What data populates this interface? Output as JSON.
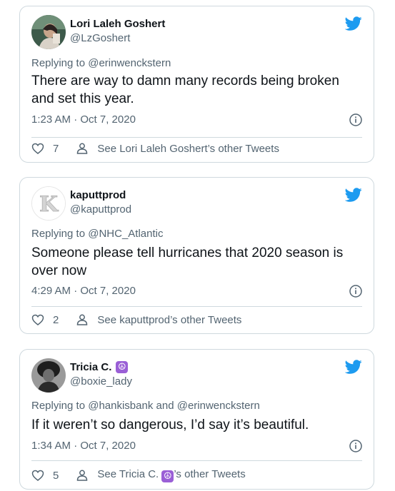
{
  "colors": {
    "twitter_blue": "#1d9bf0",
    "text_primary": "#0f1419",
    "text_secondary": "#536471",
    "border": "#cfd9de",
    "badge_purple": "#9a5fd6"
  },
  "tweets": [
    {
      "name": "Lori Laleh Goshert",
      "handle": "@LzGoshert",
      "replying_prefix": "Replying to ",
      "replying_to": "@erinwenckstern",
      "text": "There are way to damn many records being broken and set this year.",
      "timestamp": "1:23 AM · Oct 7, 2020",
      "likes": "7",
      "see_more": "See Lori Laleh Goshert’s other Tweets",
      "icons": [
        "twitter-bird-icon",
        "info-icon",
        "heart-icon",
        "person-icon"
      ]
    },
    {
      "name": "kaputtprod",
      "handle": "@kaputtprod",
      "replying_prefix": "Replying to ",
      "replying_to": "@NHC_Atlantic",
      "text": "Someone please tell hurricanes that 2020 season is over now",
      "timestamp": "4:29 AM · Oct 7, 2020",
      "likes": "2",
      "see_more": "See kaputtprod’s other Tweets",
      "avatar_letter": "K",
      "icons": [
        "twitter-bird-icon",
        "info-icon",
        "heart-icon",
        "person-icon"
      ]
    },
    {
      "name": "Tricia C.",
      "name_emoji": "☮",
      "handle": "@boxie_lady",
      "replying_prefix": "Replying to ",
      "replying_to": "@hankisbank",
      "replying_and": " and ",
      "replying_to_2": "@erinwenckstern",
      "text": "If it weren’t so dangerous, I’d say it’s beautiful.",
      "timestamp": "1:34 AM · Oct 7, 2020",
      "likes": "5",
      "see_more_prefix": "See Tricia C. ",
      "see_more_suffix": "’s other Tweets",
      "icons": [
        "twitter-bird-icon",
        "info-icon",
        "heart-icon",
        "person-icon",
        "peace-symbol-icon"
      ]
    }
  ]
}
